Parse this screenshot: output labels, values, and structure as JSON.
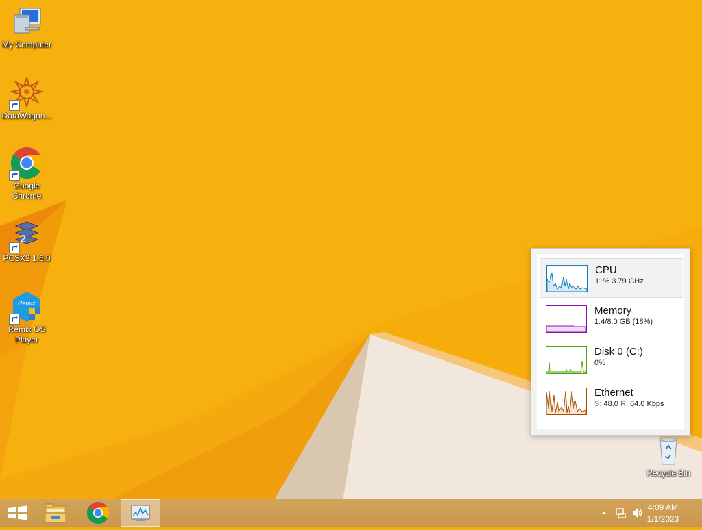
{
  "desktop": {
    "icons": [
      {
        "label": "My Computer",
        "icon": "computer-icon"
      },
      {
        "label": "DataWagon...",
        "icon": "datawagon-icon"
      },
      {
        "label": "Google Chrome",
        "icon": "chrome-icon"
      },
      {
        "label": "PCSX2 1.6.0",
        "icon": "pcsx2-icon"
      },
      {
        "label": "Remix OS Player",
        "icon": "remix-os-icon"
      },
      {
        "label": "Recycle Bin",
        "icon": "recycle-bin-icon"
      }
    ]
  },
  "perf_flyout": {
    "items": [
      {
        "name": "CPU",
        "detail": "11% 3.79 GHz",
        "color": "#117dbb"
      },
      {
        "name": "Memory",
        "detail": "1.4/8.0 GB (18%)",
        "color": "#8b12ae"
      },
      {
        "name": "Disk 0 (C:)",
        "detail": "0%",
        "color": "#4da60c"
      },
      {
        "name": "Ethernet",
        "detail_send_label": "S:",
        "detail_send": "48.0",
        "detail_recv_label": "R:",
        "detail_recv": "64.0 Kbps",
        "color": "#a74f01"
      }
    ]
  },
  "taskbar": {
    "buttons": [
      "start-icon",
      "file-explorer-icon",
      "chrome-icon",
      "task-manager-icon"
    ],
    "tray": [
      "show-hidden-icons-icon",
      "network-icon",
      "volume-icon"
    ],
    "clock_time": "4:09 AM",
    "clock_date": "1/1/2023"
  },
  "colors": {
    "wallpaper": "#f6ad0c",
    "taskbar": "#cc9b52"
  }
}
